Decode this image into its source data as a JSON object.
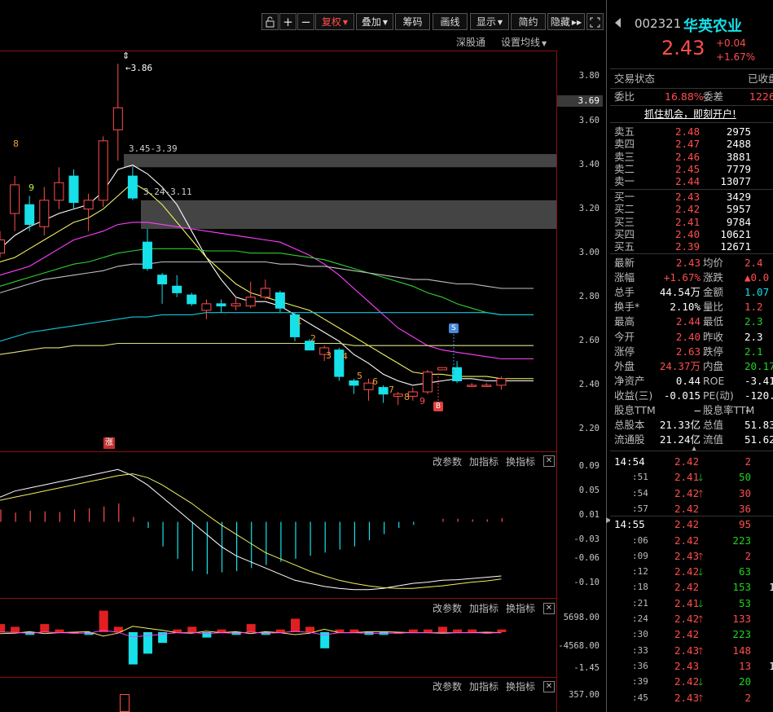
{
  "toolbar": {
    "buttons": [
      "复权",
      "叠加",
      "筹码",
      "画线",
      "显示",
      "简约",
      "隐藏"
    ],
    "sub_links": [
      "深股通",
      "设置均线"
    ]
  },
  "chart_labels": {
    "high_marker": "3.86",
    "zone1_label": "3.45-3.39",
    "zone2_label": "3.24-3.11",
    "seq_down": [
      "1",
      "2",
      "3",
      "4",
      "5",
      "6",
      "7",
      "8",
      "9"
    ],
    "seq_up_green": "9",
    "seq_up_orange": "8",
    "sell_marker": "S",
    "buy_marker": "B",
    "limit_up_marker": "涨"
  },
  "price_axis": {
    "ticks": [
      "3.80",
      "3.60",
      "3.40",
      "3.20",
      "3.00",
      "2.80",
      "2.60",
      "2.40",
      "2.20"
    ],
    "current_price": "3.69"
  },
  "indicator_controls": [
    "改参数",
    "加指标",
    "换指标"
  ],
  "macd_axis": [
    "0.09",
    "0.05",
    "0.01",
    "-0.03",
    "-0.06",
    "-0.10"
  ],
  "ind2_axis": [
    "5698.00",
    "-4568.00",
    "-1.45"
  ],
  "ind3_axis": [
    "357.00"
  ],
  "chart_data": {
    "type": "candlestick",
    "ylim": [
      2.1,
      3.92
    ],
    "candles": [
      {
        "o": 3.0,
        "c": 3.06,
        "h": 3.1,
        "l": 2.98
      },
      {
        "o": 3.18,
        "c": 3.31,
        "h": 3.35,
        "l": 3.1
      },
      {
        "o": 3.22,
        "c": 3.13,
        "h": 3.26,
        "l": 3.1
      },
      {
        "o": 3.12,
        "c": 3.24,
        "h": 3.3,
        "l": 3.08
      },
      {
        "o": 3.24,
        "c": 3.32,
        "h": 3.39,
        "l": 3.2
      },
      {
        "o": 3.35,
        "c": 3.23,
        "h": 3.38,
        "l": 3.2
      },
      {
        "o": 3.2,
        "c": 3.24,
        "h": 3.27,
        "l": 3.1
      },
      {
        "o": 3.24,
        "c": 3.51,
        "h": 3.53,
        "l": 3.21
      },
      {
        "o": 3.56,
        "c": 3.66,
        "h": 3.86,
        "l": 3.42
      },
      {
        "o": 3.35,
        "c": 3.25,
        "h": 3.39,
        "l": 3.24
      },
      {
        "o": 3.05,
        "c": 2.93,
        "h": 3.11,
        "l": 2.92
      },
      {
        "o": 2.9,
        "c": 2.86,
        "h": 2.91,
        "l": 2.77
      },
      {
        "o": 2.85,
        "c": 2.82,
        "h": 2.9,
        "l": 2.8
      },
      {
        "o": 2.81,
        "c": 2.77,
        "h": 2.82,
        "l": 2.76
      },
      {
        "o": 2.74,
        "c": 2.77,
        "h": 2.79,
        "l": 2.7
      },
      {
        "o": 2.77,
        "c": 2.76,
        "h": 2.79,
        "l": 2.73
      },
      {
        "o": 2.76,
        "c": 2.77,
        "h": 2.8,
        "l": 2.74
      },
      {
        "o": 2.76,
        "c": 2.8,
        "h": 2.87,
        "l": 2.75
      },
      {
        "o": 2.8,
        "c": 2.84,
        "h": 2.88,
        "l": 2.79
      },
      {
        "o": 2.82,
        "c": 2.75,
        "h": 2.83,
        "l": 2.73
      },
      {
        "o": 2.72,
        "c": 2.62,
        "h": 2.73,
        "l": 2.6
      },
      {
        "o": 2.6,
        "c": 2.56,
        "h": 2.61,
        "l": 2.56
      },
      {
        "o": 2.54,
        "c": 2.57,
        "h": 2.58,
        "l": 2.51
      },
      {
        "o": 2.56,
        "c": 2.44,
        "h": 2.57,
        "l": 2.42
      },
      {
        "o": 2.42,
        "c": 2.4,
        "h": 2.43,
        "l": 2.36
      },
      {
        "o": 2.38,
        "c": 2.41,
        "h": 2.43,
        "l": 2.33
      },
      {
        "o": 2.39,
        "c": 2.36,
        "h": 2.4,
        "l": 2.32
      },
      {
        "o": 2.35,
        "c": 2.36,
        "h": 2.37,
        "l": 2.31
      },
      {
        "o": 2.35,
        "c": 2.37,
        "h": 2.39,
        "l": 2.33
      },
      {
        "o": 2.37,
        "c": 2.46,
        "h": 2.47,
        "l": 2.36
      },
      {
        "o": 2.47,
        "c": 2.48,
        "h": 2.48,
        "l": 2.47
      },
      {
        "o": 2.48,
        "c": 2.42,
        "h": 2.51,
        "l": 2.41
      },
      {
        "o": 2.4,
        "c": 2.4,
        "h": 2.41,
        "l": 2.4
      },
      {
        "o": 2.4,
        "c": 2.4,
        "h": 2.41,
        "l": 2.4
      },
      {
        "o": 2.4,
        "c": 2.43,
        "h": 2.44,
        "l": 2.38
      }
    ],
    "zones": [
      {
        "from": 3.39,
        "to": 3.45
      },
      {
        "from": 3.11,
        "to": 3.24
      }
    ],
    "ma_series": [
      {
        "color": "#ffffff",
        "values": [
          3.02,
          3.08,
          3.12,
          3.15,
          3.18,
          3.2,
          3.22,
          3.28,
          3.38,
          3.4,
          3.36,
          3.3,
          3.22,
          3.1,
          2.98,
          2.88,
          2.8,
          2.78,
          2.78,
          2.76,
          2.72,
          2.68,
          2.64,
          2.6,
          2.54,
          2.5,
          2.45,
          2.42,
          2.4,
          2.41,
          2.42,
          2.43,
          2.43,
          2.42,
          2.42
        ]
      },
      {
        "color": "#f0f060",
        "values": [
          2.96,
          2.98,
          3.02,
          3.06,
          3.1,
          3.14,
          3.16,
          3.2,
          3.26,
          3.32,
          3.28,
          3.22,
          3.14,
          3.06,
          2.98,
          2.92,
          2.86,
          2.82,
          2.8,
          2.78,
          2.76,
          2.74,
          2.7,
          2.66,
          2.62,
          2.58,
          2.54,
          2.5,
          2.46,
          2.45,
          2.45,
          2.44,
          2.44,
          2.44,
          2.43
        ]
      },
      {
        "color": "#ff40ff",
        "values": [
          2.9,
          2.92,
          2.94,
          2.98,
          3.02,
          3.06,
          3.08,
          3.1,
          3.13,
          3.14,
          3.14,
          3.13,
          3.12,
          3.11,
          3.1,
          3.09,
          3.08,
          3.07,
          3.06,
          3.05,
          3.02,
          2.99,
          2.95,
          2.9,
          2.84,
          2.78,
          2.72,
          2.66,
          2.62,
          2.58,
          2.56,
          2.55,
          2.54,
          2.53,
          2.52
        ]
      },
      {
        "color": "#30d030",
        "values": [
          2.85,
          2.87,
          2.89,
          2.91,
          2.93,
          2.95,
          2.96,
          2.98,
          3.0,
          3.01,
          3.02,
          3.02,
          3.02,
          3.02,
          3.01,
          3.01,
          3.01,
          3.0,
          3.0,
          3.0,
          2.99,
          2.98,
          2.97,
          2.95,
          2.93,
          2.91,
          2.89,
          2.87,
          2.85,
          2.82,
          2.8,
          2.77,
          2.75,
          2.73,
          2.72
        ]
      },
      {
        "color": "#c0c0c0",
        "values": [
          2.82,
          2.84,
          2.86,
          2.88,
          2.89,
          2.9,
          2.91,
          2.92,
          2.94,
          2.95,
          2.95,
          2.96,
          2.96,
          2.96,
          2.96,
          2.96,
          2.96,
          2.96,
          2.96,
          2.95,
          2.95,
          2.94,
          2.94,
          2.93,
          2.92,
          2.91,
          2.9,
          2.89,
          2.88,
          2.88,
          2.87,
          2.86,
          2.86,
          2.85,
          2.84
        ]
      },
      {
        "color": "#10c8e0",
        "values": [
          2.6,
          2.62,
          2.64,
          2.65,
          2.66,
          2.67,
          2.68,
          2.69,
          2.7,
          2.71,
          2.71,
          2.72,
          2.72,
          2.72,
          2.73,
          2.73,
          2.73,
          2.73,
          2.73,
          2.73,
          2.73,
          2.73,
          2.73,
          2.73,
          2.73,
          2.73,
          2.73,
          2.73,
          2.73,
          2.73,
          2.73,
          2.73,
          2.73,
          2.73,
          2.72
        ]
      },
      {
        "color": "#e0e080",
        "values": [
          2.54,
          2.55,
          2.56,
          2.57,
          2.57,
          2.58,
          2.58,
          2.58,
          2.59,
          2.59,
          2.59,
          2.59,
          2.59,
          2.59,
          2.59,
          2.59,
          2.59,
          2.59,
          2.59,
          2.59,
          2.59,
          2.59,
          2.59,
          2.59,
          2.58,
          2.58,
          2.58,
          2.58,
          2.58,
          2.58,
          2.58,
          2.58,
          2.58,
          2.58,
          2.58
        ]
      }
    ],
    "macd_hist": [
      0.02,
      0.015,
      0.018,
      0.017,
      0.016,
      0.02,
      0.022,
      0.025,
      0.03,
      0.008,
      -0.01,
      -0.04,
      -0.06,
      -0.08,
      -0.085,
      -0.082,
      -0.08,
      -0.075,
      -0.07,
      -0.065,
      -0.06,
      -0.055,
      -0.05,
      -0.045,
      -0.04,
      -0.03,
      -0.02,
      -0.01,
      -0.005,
      0.0,
      0.005,
      0.005,
      0.004,
      0.004,
      0.006
    ],
    "macd_dif": [
      0.04,
      0.05,
      0.055,
      0.06,
      0.065,
      0.07,
      0.075,
      0.08,
      0.085,
      0.075,
      0.06,
      0.04,
      0.02,
      0.0,
      -0.02,
      -0.04,
      -0.055,
      -0.065,
      -0.075,
      -0.085,
      -0.095,
      -0.1,
      -0.105,
      -0.108,
      -0.11,
      -0.11,
      -0.108,
      -0.104,
      -0.1,
      -0.098,
      -0.095,
      -0.094,
      -0.092,
      -0.09,
      -0.088
    ],
    "macd_dea": [
      0.035,
      0.04,
      0.045,
      0.05,
      0.055,
      0.06,
      0.065,
      0.07,
      0.075,
      0.078,
      0.072,
      0.06,
      0.045,
      0.03,
      0.012,
      -0.005,
      -0.02,
      -0.035,
      -0.05,
      -0.06,
      -0.07,
      -0.08,
      -0.088,
      -0.095,
      -0.1,
      -0.104,
      -0.107,
      -0.108,
      -0.108,
      -0.106,
      -0.104,
      -0.101,
      -0.098,
      -0.096,
      -0.093
    ]
  },
  "quote": {
    "code": "002321",
    "name": "华英农业",
    "price": "2.43",
    "change": "+0.04",
    "change_pct": "+1.67%",
    "status_label": "交易状态",
    "status_value": "已收盘",
    "ratio_label": "委比",
    "ratio_value": "16.88%",
    "diff_label": "委差",
    "diff_value": "1226",
    "promo": "抓住机会，即刻开户!"
  },
  "order_book": {
    "asks": [
      {
        "label": "卖五",
        "price": "2.48",
        "vol": "2975"
      },
      {
        "label": "卖四",
        "price": "2.47",
        "vol": "2488"
      },
      {
        "label": "卖三",
        "price": "2.46",
        "vol": "3881"
      },
      {
        "label": "卖二",
        "price": "2.45",
        "vol": "7779"
      },
      {
        "label": "卖一",
        "price": "2.44",
        "vol": "13077"
      }
    ],
    "bids": [
      {
        "label": "买一",
        "price": "2.43",
        "vol": "3429"
      },
      {
        "label": "买二",
        "price": "2.42",
        "vol": "5957"
      },
      {
        "label": "买三",
        "price": "2.41",
        "vol": "9784"
      },
      {
        "label": "买四",
        "price": "2.40",
        "vol": "10621"
      },
      {
        "label": "买五",
        "price": "2.39",
        "vol": "12671"
      }
    ]
  },
  "stats": [
    {
      "l1": "最新",
      "v1": "2.43",
      "c1": "red",
      "l2": "均价",
      "v2": "2.4",
      "c2": "red"
    },
    {
      "l1": "涨幅",
      "v1": "+1.67%",
      "c1": "red",
      "l2": "涨跌",
      "v2": "▲0.0",
      "c2": "red"
    },
    {
      "l1": "总手",
      "v1": "44.54万",
      "c1": "white",
      "l2": "金额",
      "v2": "1.07",
      "c2": "cyan"
    },
    {
      "l1": "换手*",
      "v1": "2.10%",
      "c1": "white",
      "l2": "量比",
      "v2": "1.2",
      "c2": "red"
    },
    {
      "l1": "最高",
      "v1": "2.44",
      "c1": "red",
      "l2": "最低",
      "v2": "2.3",
      "c2": "green"
    },
    {
      "l1": "今开",
      "v1": "2.40",
      "c1": "red",
      "l2": "昨收",
      "v2": "2.3",
      "c2": "white"
    },
    {
      "l1": "涨停",
      "v1": "2.63",
      "c1": "red",
      "l2": "跌停",
      "v2": "2.1",
      "c2": "green"
    },
    {
      "l1": "外盘",
      "v1": "24.37万",
      "c1": "red",
      "l2": "内盘",
      "v2": "20.17",
      "c2": "green"
    },
    {
      "l1": "净资产",
      "v1": "0.44",
      "c1": "white",
      "l2": "ROE",
      "v2": "-3.41",
      "c2": "white"
    },
    {
      "l1": "收益(三)",
      "v1": "-0.015",
      "c1": "white",
      "l2": "PE(动)",
      "v2": "-120.6",
      "c2": "white"
    },
    {
      "l1": "股息TTM",
      "v1": "—",
      "c1": "white",
      "l2": "股息率TTM",
      "v2": "-",
      "c2": "white"
    },
    {
      "l1": "总股本",
      "v1": "21.33亿",
      "c1": "white",
      "l2": "总值",
      "v2": "51.83",
      "c2": "white"
    },
    {
      "l1": "流通股",
      "v1": "21.24亿",
      "c1": "white",
      "l2": "流值",
      "v2": "51.62",
      "c2": "white"
    }
  ],
  "ticks": [
    {
      "time": "14:54",
      "price": "2.42",
      "arrow": "",
      "vol": "2",
      "extra": ""
    },
    {
      "time": ":51",
      "price": "2.41",
      "arrow": "down",
      "vol": "50",
      "extra": ""
    },
    {
      "time": ":54",
      "price": "2.42",
      "arrow": "up",
      "vol": "30",
      "extra": ""
    },
    {
      "time": ":57",
      "price": "2.42",
      "arrow": "",
      "vol": "36",
      "extra": ""
    },
    {
      "time": "14:55",
      "price": "2.42",
      "arrow": "",
      "vol": "95",
      "extra": ""
    },
    {
      "time": ":06",
      "price": "2.42",
      "arrow": "",
      "vol": "223",
      "extra": ""
    },
    {
      "time": ":09",
      "price": "2.43",
      "arrow": "up",
      "vol": "2",
      "extra": ""
    },
    {
      "time": ":12",
      "price": "2.42",
      "arrow": "down",
      "vol": "63",
      "extra": ""
    },
    {
      "time": ":18",
      "price": "2.42",
      "arrow": "",
      "vol": "153",
      "extra": "1"
    },
    {
      "time": ":21",
      "price": "2.41",
      "arrow": "down",
      "vol": "53",
      "extra": ""
    },
    {
      "time": ":24",
      "price": "2.42",
      "arrow": "up",
      "vol": "133",
      "extra": ""
    },
    {
      "time": ":30",
      "price": "2.42",
      "arrow": "",
      "vol": "223",
      "extra": ""
    },
    {
      "time": ":33",
      "price": "2.43",
      "arrow": "up",
      "vol": "148",
      "extra": ""
    },
    {
      "time": ":36",
      "price": "2.43",
      "arrow": "",
      "vol": "13",
      "extra": "1"
    },
    {
      "time": ":39",
      "price": "2.42",
      "arrow": "down",
      "vol": "20",
      "extra": ""
    },
    {
      "time": ":45",
      "price": "2.43",
      "arrow": "up",
      "vol": "2",
      "extra": ""
    }
  ]
}
